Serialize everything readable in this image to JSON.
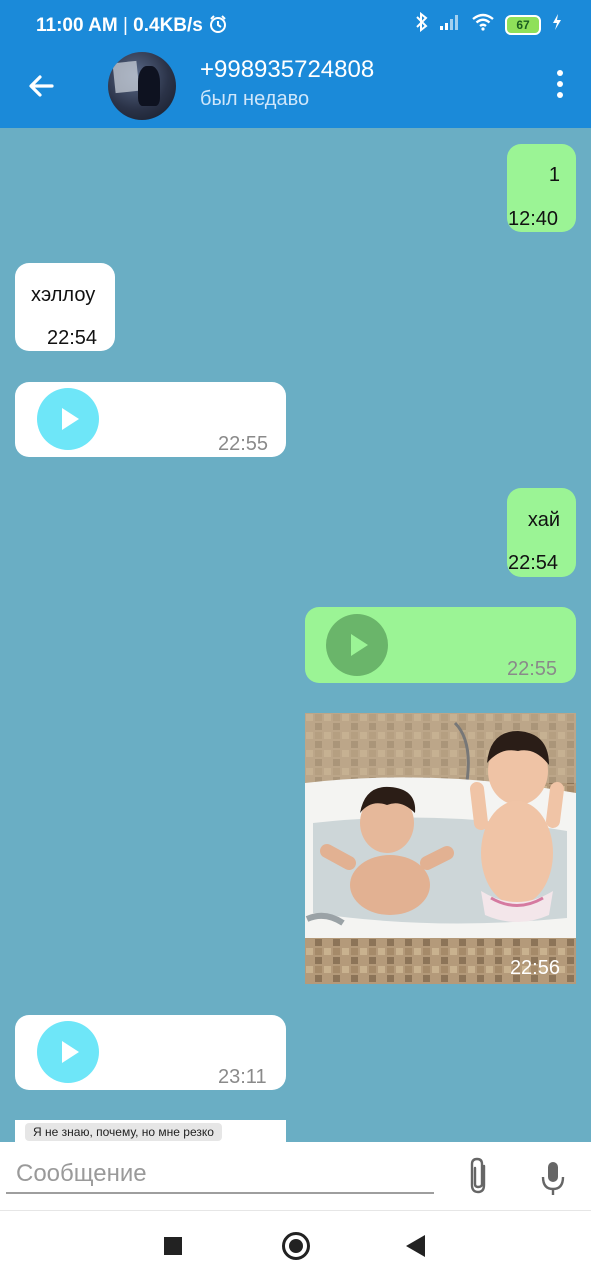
{
  "status_bar": {
    "time": "11:00 AM",
    "separator": "|",
    "speed": "0.4KB/s",
    "battery": "67",
    "icons": [
      "alarm-icon",
      "bluetooth-icon",
      "signal-icon",
      "wifi-icon",
      "battery-icon",
      "charging-icon"
    ]
  },
  "header": {
    "contact_name": "+998935724808",
    "contact_status": "был недаво",
    "icons": [
      "back-arrow-icon",
      "avatar",
      "more-vertical-icon"
    ]
  },
  "messages": [
    {
      "type": "text",
      "direction": "outgoing",
      "text": "1",
      "time": "12:40"
    },
    {
      "type": "text",
      "direction": "incoming",
      "text": "хэллоу",
      "time": "22:54"
    },
    {
      "type": "voice",
      "direction": "incoming",
      "time": "22:55"
    },
    {
      "type": "text",
      "direction": "outgoing",
      "text": "хай",
      "time": "22:54"
    },
    {
      "type": "voice",
      "direction": "outgoing",
      "time": "22:55"
    },
    {
      "type": "photo",
      "direction": "outgoing",
      "time": "22:56"
    },
    {
      "type": "voice",
      "direction": "incoming",
      "time": "23:11"
    },
    {
      "type": "image-partial",
      "direction": "incoming",
      "text": "Я не знаю, почему, но мне резко"
    }
  ],
  "composer": {
    "placeholder": "Сообщение",
    "value": "",
    "icons": [
      "paperclip-icon",
      "microphone-icon"
    ]
  },
  "navigation": {
    "icons": [
      "recents-icon",
      "home-icon",
      "back-icon"
    ]
  },
  "colors": {
    "app_bar": "#1b8ad9",
    "chat_background": "#6aaec4",
    "outgoing_bubble": "#9bf495",
    "incoming_bubble": "#ffffff",
    "incoming_play_button": "#6ee6f8",
    "outgoing_play_button": "#6ab56a"
  }
}
